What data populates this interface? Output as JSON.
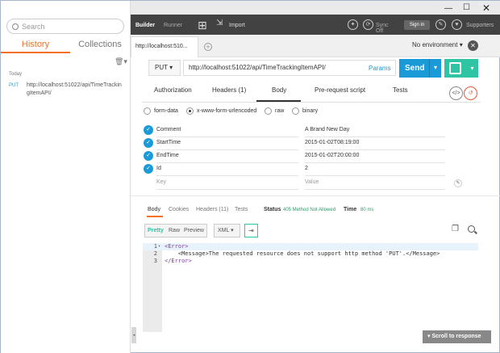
{
  "left": {
    "search_placeholder": "Search",
    "tab_history": "History",
    "tab_collections": "Collections",
    "group": "Today",
    "history": [
      {
        "method": "PUT",
        "url": "http://localhost:51022/api/TimeTrackingItemAPI/"
      }
    ]
  },
  "topbar": {
    "builder": "Builder",
    "runner": "Runner",
    "import": "Import",
    "sync": "Sync Off",
    "signin": "Sign in",
    "supporters": "Supporters"
  },
  "tabbar": {
    "tab_label": "http://localhost:510...",
    "environment": "No environment"
  },
  "request": {
    "method": "PUT",
    "url": "http://localhost:51022/api/TimeTrackingItemAPI/",
    "params": "Params",
    "send": "Send"
  },
  "subtabs": [
    "Authorization",
    "Headers (1)",
    "Body",
    "Pre-request script",
    "Tests"
  ],
  "body_modes": [
    "form-data",
    "x-www-form-urlencoded",
    "raw",
    "binary"
  ],
  "kv": [
    {
      "key": "Comment",
      "value": "A Brand New Day"
    },
    {
      "key": "StartTime",
      "value": "2015-01-02T08:19:00"
    },
    {
      "key": "EndTime",
      "value": "2015-01-02T20:00:00"
    },
    {
      "key": "Id",
      "value": "2"
    }
  ],
  "kv_placeholder": {
    "key": "Key",
    "value": "Value"
  },
  "response": {
    "tabs": [
      "Body",
      "Cookies",
      "Headers (11)",
      "Tests"
    ],
    "status_label": "Status",
    "status_value": "405 Method Not Allowed",
    "time_label": "Time",
    "time_value": "80 ms",
    "formats": [
      "Pretty",
      "Raw",
      "Preview"
    ],
    "lang": "XML",
    "lines": [
      {
        "num": "1",
        "text": "<Error>"
      },
      {
        "num": "2",
        "text": "    <Message>The requested resource does not support http method 'PUT'.</Message>"
      },
      {
        "num": "3",
        "text": "</Error>"
      }
    ],
    "scroll_btn": "Scroll to response"
  },
  "colors": {
    "accent": "#f47023",
    "primary": "#1a9bd7",
    "save": "#2ec4a4",
    "status": "#2a9d6a"
  }
}
